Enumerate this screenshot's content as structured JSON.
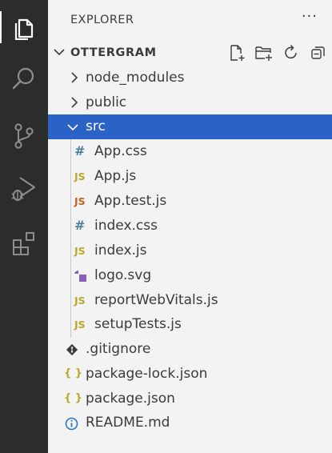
{
  "sidebar": {
    "title": "EXPLORER",
    "more_label": "···"
  },
  "project": {
    "name": "OTTERGRAM"
  },
  "activity_bar": {
    "items": [
      {
        "name": "explorer-icon"
      },
      {
        "name": "search-icon"
      },
      {
        "name": "source-control-icon"
      },
      {
        "name": "run-debug-icon"
      },
      {
        "name": "extensions-icon"
      }
    ]
  },
  "tree": {
    "folders": [
      {
        "label": "node_modules",
        "icon": "chevron-right-icon"
      },
      {
        "label": "public",
        "icon": "chevron-right-icon"
      },
      {
        "label": "src",
        "icon": "chevron-down-icon"
      }
    ],
    "src_files": [
      {
        "label": "App.css",
        "icon": "css-file-icon",
        "glyph": "#",
        "color": "#4d7f9a"
      },
      {
        "label": "App.js",
        "icon": "js-file-icon",
        "glyph": "JS",
        "color": "#b8a92a"
      },
      {
        "label": "App.test.js",
        "icon": "test-js-file-icon",
        "glyph": "JS",
        "color": "#c06224"
      },
      {
        "label": "index.css",
        "icon": "css-file-icon",
        "glyph": "#",
        "color": "#4d7f9a"
      },
      {
        "label": "index.js",
        "icon": "js-file-icon",
        "glyph": "JS",
        "color": "#b8a92a"
      },
      {
        "label": "logo.svg",
        "icon": "svg-file-icon",
        "color": "#8a5fb7"
      },
      {
        "label": "reportWebVitals.js",
        "icon": "js-file-icon",
        "glyph": "JS",
        "color": "#b8a92a"
      },
      {
        "label": "setupTests.js",
        "icon": "js-file-icon",
        "glyph": "JS",
        "color": "#b8a92a"
      }
    ],
    "root_files": [
      {
        "label": ".gitignore",
        "icon": "git-file-icon",
        "color": "#3b3b3b"
      },
      {
        "label": "package-lock.json",
        "icon": "json-file-icon",
        "glyph": "{ }",
        "color": "#b8a92a"
      },
      {
        "label": "package.json",
        "icon": "json-file-icon",
        "glyph": "{ }",
        "color": "#b8a92a"
      },
      {
        "label": "README.md",
        "icon": "info-icon",
        "color": "#2b74c4"
      }
    ]
  }
}
